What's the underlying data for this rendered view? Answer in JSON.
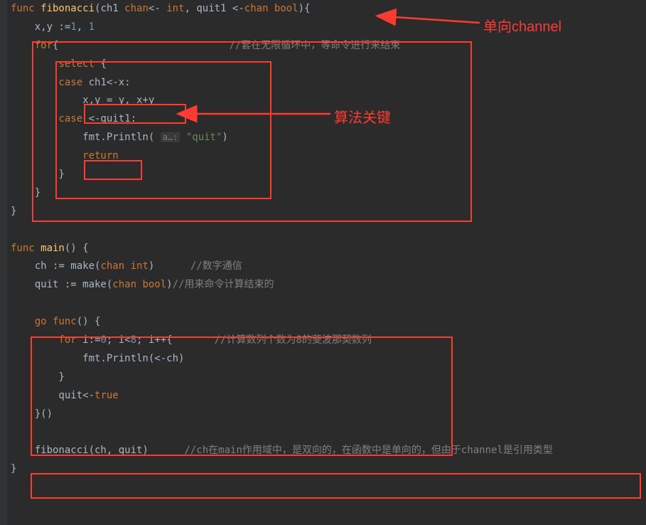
{
  "code": {
    "l1_func": "func",
    "l1_name": " fibonacci",
    "l1_sig_a": "(ch1 ",
    "l1_chan": "chan",
    "l1_sig_b": "<- ",
    "l1_int": "int",
    "l1_sig_c": ", quit1 <-",
    "l1_chan2": "chan",
    "l1_sig_d": " ",
    "l1_bool": "bool",
    "l1_sig_e": "){",
    "l2_a": "    x,y :=",
    "l2_n1": "1",
    "l2_b": ", ",
    "l2_n2": "1",
    "l3_for": "    for",
    "l3_b": "{",
    "l3_cm": "//套在无限循环中，等命令进行来结束",
    "l4_sel": "        select ",
    "l4_b": "{",
    "l5_case": "        case ",
    "l5_b": "ch1<-x:",
    "l6_a": "            x,y = y, x+y",
    "l7_case": "        case ",
    "l7_b": "<-quit1:",
    "l8_a": "            fmt.Println( ",
    "l8_hint": "a…:",
    "l8_b": " ",
    "l8_str": "\"quit\"",
    "l8_c": ")",
    "l9_ret": "            return",
    "l10": "        }",
    "l11": "    }",
    "l12": "}",
    "l14_func": "func",
    "l14_main": " main",
    "l14_b": "() {",
    "l15_a": "    ch := make(",
    "l15_chan": "chan int",
    "l15_b": ")",
    "l15_cm": "      //数字通信",
    "l16_a": "    quit := make(",
    "l16_chan": "chan bool",
    "l16_b": ")",
    "l16_cm": "//用来命令计算结束的",
    "l18_go": "    go func",
    "l18_b": "() {",
    "l19_for": "        for ",
    "l19_a": "i:=",
    "l19_n0": "0",
    "l19_b": "; i<",
    "l19_n8": "8",
    "l19_c": "; i++{",
    "l19_cm": "       //计算数列个数为8的斐波那契数列",
    "l20_a": "            fmt.Println(<-ch)",
    "l21": "        }",
    "l22_a": "        quit<-",
    "l22_true": "true",
    "l23": "    }()",
    "l25_a": "    fibonacci(ch, quit)",
    "l25_cm": "      //ch在main作用域中，是双向的，在函数中是单向的，但由于channel是引用类型",
    "l26": "}"
  },
  "annotations": {
    "a1": "单向channel",
    "a2": "算法关键"
  }
}
